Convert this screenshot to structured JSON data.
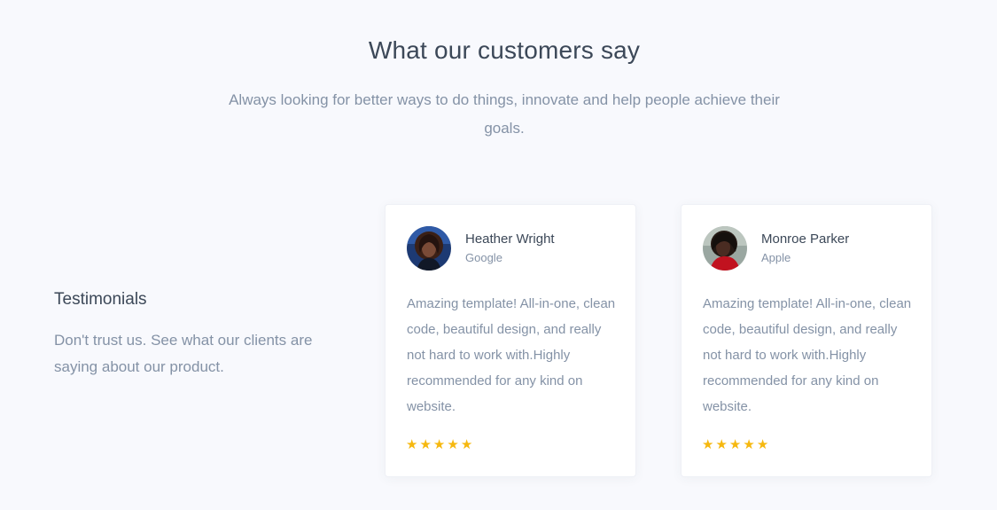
{
  "header": {
    "title": "What our customers say",
    "subtitle": "Always looking for better ways to do things, innovate and help people achieve their goals."
  },
  "intro": {
    "title": "Testimonials",
    "text": "Don't trust us. See what our clients are saying about our product."
  },
  "testimonials": [
    {
      "name": "Heather Wright",
      "company": "Google",
      "quote": "Amazing template! All-in-one, clean code, beautiful design, and really not hard to work with.Highly recommended for any kind on website.",
      "rating": 5,
      "avatar_icon": "person-avatar"
    },
    {
      "name": "Monroe Parker",
      "company": "Apple",
      "quote": "Amazing template! All-in-one, clean code, beautiful design, and really not hard to work with.Highly recommended for any kind on website.",
      "rating": 5,
      "avatar_icon": "person-avatar"
    }
  ],
  "colors": {
    "page_background": "#f8f9fd",
    "heading": "#3c4858",
    "muted_text": "#8492a6",
    "star": "#f6b80f",
    "card": "#ffffff"
  }
}
